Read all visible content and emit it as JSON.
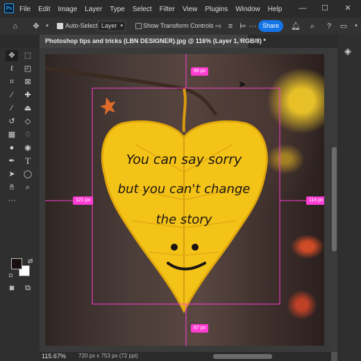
{
  "menubar": {
    "app_icon": "Ps",
    "items": [
      "File",
      "Edit",
      "Image",
      "Layer",
      "Type",
      "Select",
      "Filter",
      "View",
      "Plugins",
      "Window",
      "Help"
    ],
    "window_controls": [
      "minimize-icon",
      "maximize-icon",
      "close-icon"
    ]
  },
  "options_bar": {
    "auto_select_label": "Auto-Select:",
    "auto_select_checked": true,
    "layer_select_value": "Layer",
    "show_transform_label": "Show Transform Controls",
    "show_transform_checked": false,
    "share_label": "Share"
  },
  "document": {
    "tab_title": "Photoshop tips and tricks (LBN DESIGNER).jpg @ 116% (Layer 1, RGB/8) *",
    "tab_close": "×"
  },
  "canvas": {
    "artwork_text_lines": [
      "You can say sorry",
      "but you can't change",
      "the story"
    ],
    "measurements": {
      "top": "89 px",
      "left": "121 px",
      "right": "114 px",
      "bottom": "87 px"
    },
    "guide_color": "#ff3dd3",
    "leaf_color": "#f4c318"
  },
  "toolbar": {
    "foreground_color": "#1a0f0f",
    "background_color": "#ffffff",
    "tools": [
      "move-tool",
      "artboard-tool",
      "lasso-tool",
      "object-select-tool",
      "crop-tool",
      "frame-tool",
      "eyedropper-tool",
      "spot-healing-tool",
      "brush-tool",
      "clone-stamp-tool",
      "history-brush-tool",
      "eraser-tool",
      "gradient-tool",
      "blur-tool",
      "dodge-tool",
      "pen-tool",
      "type-tool",
      "path-select-tool",
      "ellipse-tool",
      "hand-tool",
      "zoom-tool",
      "more-tools"
    ]
  },
  "statusbar": {
    "zoom": "115.67%",
    "doc_size": "720 px x 753 px (72 ppi)"
  }
}
